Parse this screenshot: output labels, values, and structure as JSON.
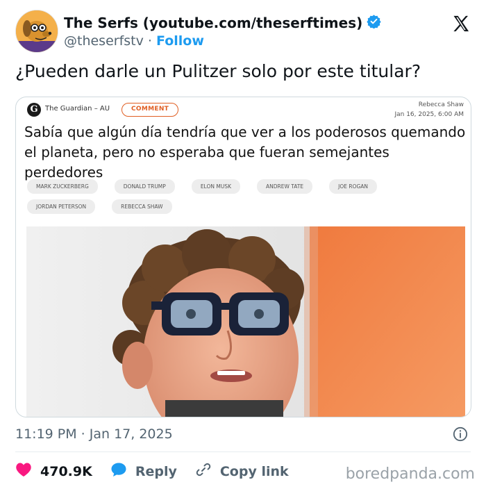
{
  "tweet": {
    "display_name": "The Serfs (youtube.com/theserftimes)",
    "handle": "@theserfstv",
    "separator": "·",
    "follow_label": "Follow",
    "text": "¿Pueden darle un Pulitzer solo por este titular?",
    "timestamp": "11:19 PM · Jan 17, 2025",
    "likes": "470.9K",
    "reply_label": "Reply",
    "copy_link_label": "Copy link"
  },
  "card": {
    "outlet": "The Guardian – AU",
    "badge": "COMMENT",
    "author": "Rebecca Shaw",
    "date": "Jan 16, 2025, 6:00 AM",
    "headline": "Sabía que algún día tendría que ver a los poderosos quemando el planeta, pero no esperaba que fueran semejantes perdedores",
    "tags": [
      "MARK ZUCKERBERG",
      "DONALD TRUMP",
      "ELON MUSK",
      "ANDREW TATE",
      "JOE ROGAN",
      "JORDAN PETERSON",
      "REBECCA SHAW"
    ]
  },
  "watermark": "boredpanda.com",
  "colors": {
    "accent_blue": "#1d9bf0",
    "like_red": "#f91880",
    "badge_orange": "#e05e22",
    "muted_text": "#536471"
  },
  "icons": [
    "verified-badge-icon",
    "x-logo-icon",
    "info-icon",
    "heart-icon",
    "reply-bubble-icon",
    "link-icon"
  ]
}
